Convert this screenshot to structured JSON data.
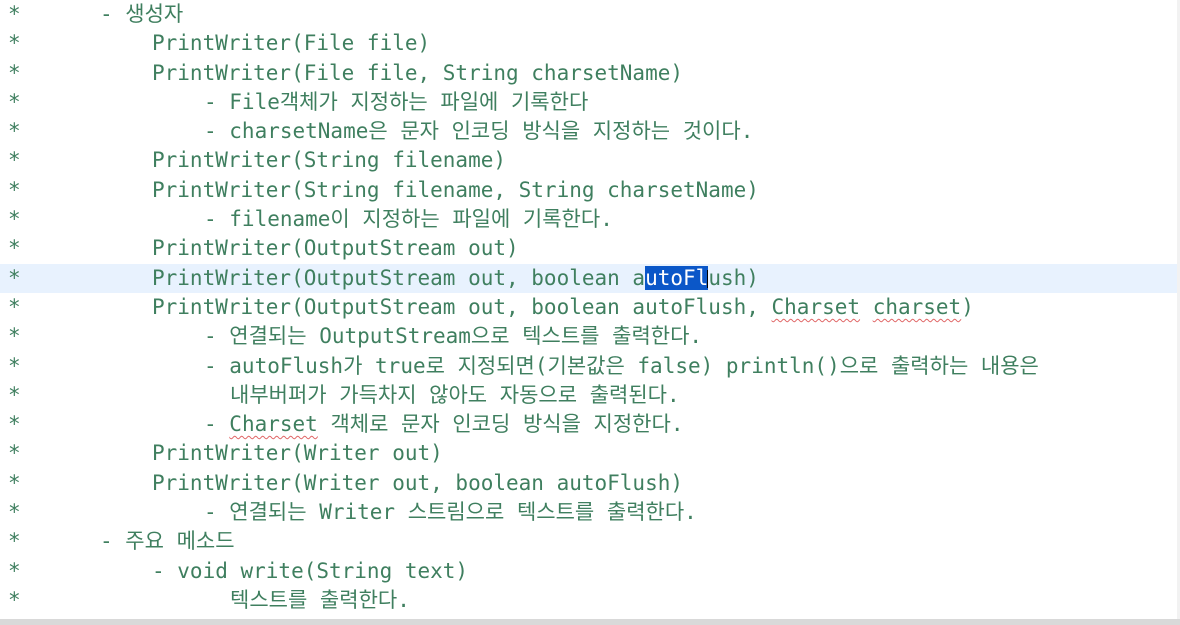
{
  "editor": {
    "comment_marker": "*",
    "lines": [
      {
        "text": "- 생성자",
        "indent": 1
      },
      {
        "text": "PrintWriter(File file)",
        "indent": 2
      },
      {
        "text": "PrintWriter(File file, String charsetName)",
        "indent": 2
      },
      {
        "text": "- File객체가 지정하는 파일에 기록한다",
        "indent": 3
      },
      {
        "text": "- charsetName은 문자 인코딩 방식을 지정하는 것이다.",
        "indent": 3
      },
      {
        "text": "PrintWriter(String filename)",
        "indent": 2
      },
      {
        "text": "PrintWriter(String filename, String charsetName)",
        "indent": 2
      },
      {
        "text": "- filename이 지정하는 파일에 기록한다.",
        "indent": 3
      },
      {
        "text": "PrintWriter(OutputStream out)",
        "indent": 2
      },
      {
        "text": "PrintWriter(OutputStream out, boolean autoFlush)",
        "indent": 2,
        "current": true,
        "selection": "utoFl"
      },
      {
        "text": "PrintWriter(OutputStream out, boolean autoFlush, Charset charset)",
        "indent": 2,
        "squiggles": [
          "Charset",
          "charset"
        ]
      },
      {
        "text": "- 연결되는 OutputStream으로 텍스트를 출력한다.",
        "indent": 3
      },
      {
        "text": "- autoFlush가 true로 지정되면(기본값은 false) println()으로 출력하는 내용은",
        "indent": 3
      },
      {
        "text": "내부버퍼가 가득차지 않아도 자동으로 출력된다.",
        "indent": 4
      },
      {
        "text": "- Charset 객체로 문자 인코딩 방식을 지정한다.",
        "indent": 3,
        "squiggles": [
          "Charset"
        ]
      },
      {
        "text": "PrintWriter(Writer out)",
        "indent": 2
      },
      {
        "text": "PrintWriter(Writer out, boolean autoFlush)",
        "indent": 2
      },
      {
        "text": "- 연결되는 Writer 스트림으로 텍스트를 출력한다.",
        "indent": 3
      },
      {
        "text": "- 주요 메소드",
        "indent": 1
      },
      {
        "text": "- void write(String text)",
        "indent": 2
      },
      {
        "text": "텍스트를 출력한다.",
        "indent": 4
      }
    ]
  },
  "colors": {
    "comment_text": "#3f7f5f",
    "current_line": "#e8f2fe",
    "selection": "#0b57c8"
  }
}
